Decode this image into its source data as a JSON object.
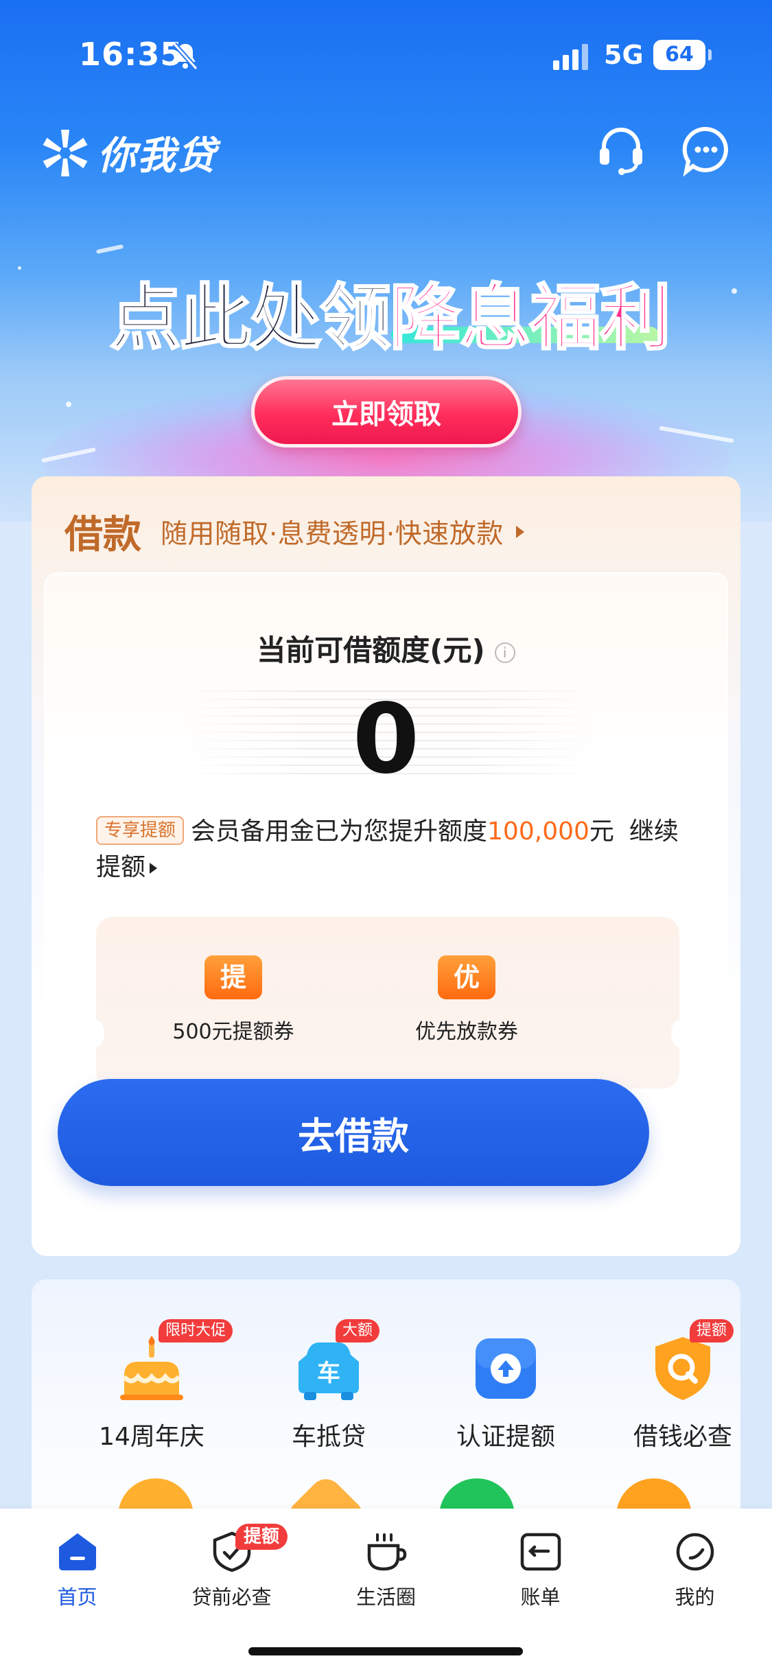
{
  "status_bar": {
    "time": "16:35",
    "network": "5G",
    "battery": "64"
  },
  "header": {
    "app_name": "你我贷"
  },
  "promo": {
    "title_dark": "点此处领",
    "title_highlight": "降息福利",
    "cta": "立即领取"
  },
  "loan": {
    "title": "借款",
    "subtitle": "随用随取·息费透明·快速放款",
    "limit_label": "当前可借额度(元)",
    "limit_value": "0",
    "boost_tag": "专享提额",
    "boost_text_before": "会员备用金已为您提升额度",
    "boost_amount": "100,000",
    "boost_text_after": "元",
    "boost_link": "继续提额",
    "coupons": [
      {
        "badge": "提",
        "label": "500元提额券"
      },
      {
        "badge": "优",
        "label": "优先放款券"
      }
    ],
    "primary_button": "去借款"
  },
  "features": [
    {
      "label": "14周年庆",
      "tag": "限时大促",
      "icon": "cake-icon"
    },
    {
      "label": "车抵贷",
      "tag": "大额",
      "icon": "car-icon"
    },
    {
      "label": "认证提额",
      "tag": "",
      "icon": "upload-arrow-icon"
    },
    {
      "label": "借钱必查",
      "tag": "提额",
      "icon": "search-shield-icon"
    }
  ],
  "tabbar": [
    {
      "label": "首页",
      "icon": "home-icon",
      "active": true,
      "badge": ""
    },
    {
      "label": "贷前必查",
      "icon": "shield-check-icon",
      "active": false,
      "badge": "提额"
    },
    {
      "label": "生活圈",
      "icon": "cup-icon",
      "active": false,
      "badge": ""
    },
    {
      "label": "账单",
      "icon": "bill-icon",
      "active": false,
      "badge": ""
    },
    {
      "label": "我的",
      "icon": "profile-icon",
      "active": false,
      "badge": ""
    }
  ],
  "colors": {
    "brand_blue": "#1d5adf",
    "accent_orange": "#ff6a1a",
    "promo_pink": "#ff2e8e"
  }
}
